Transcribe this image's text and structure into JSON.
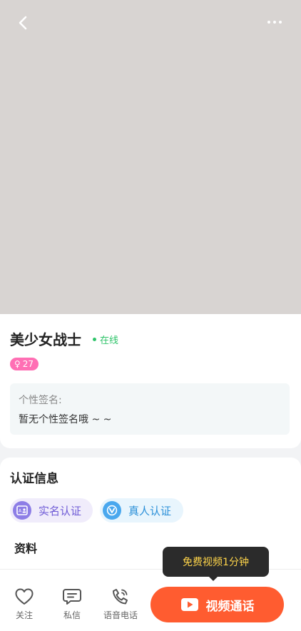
{
  "header": {
    "back_icon": "chevron-left-icon",
    "more_icon": "more-dots-icon"
  },
  "profile": {
    "name": "美少女战士",
    "status": "在线",
    "status_color": "#2fc46a",
    "gender_symbol": "♀",
    "age": "27",
    "badge_color": "#ff6fb4",
    "signature_label": "个性签名:",
    "signature_text": "暂无个性签名哦 ~ ~"
  },
  "verification": {
    "title": "认证信息",
    "items": [
      {
        "label": "实名认证",
        "icon": "id-card-icon",
        "color": "#6e5ad6"
      },
      {
        "label": "真人认证",
        "icon": "verified-v-icon",
        "color": "#2a8fd8"
      }
    ]
  },
  "profile_section": {
    "title": "资料"
  },
  "promo": {
    "tooltip": "免费视频1分钟"
  },
  "bottom_bar": {
    "follow_label": "关注",
    "message_label": "私信",
    "voice_call_label": "语音电话",
    "video_call_label": "视频通话",
    "video_call_color": "#ff5c30"
  }
}
